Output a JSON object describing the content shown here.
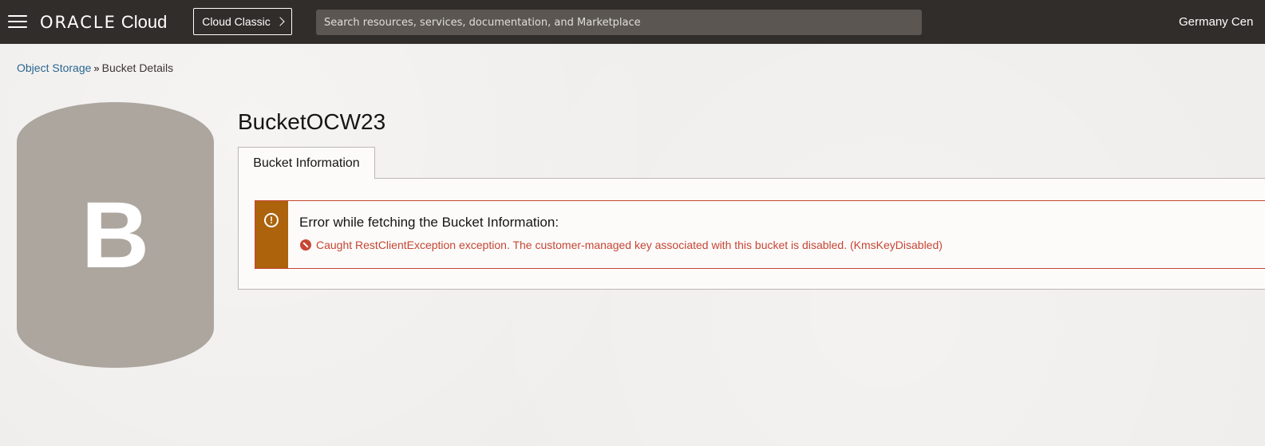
{
  "header": {
    "brand_oracle": "ORACLE",
    "brand_cloud": "Cloud",
    "classic_button_label": "Cloud Classic",
    "search_placeholder": "Search resources, services, documentation, and Marketplace",
    "region_label": "Germany Cen"
  },
  "breadcrumb": {
    "parent_label": "Object Storage",
    "separator": "»",
    "current_label": "Bucket Details"
  },
  "bucket": {
    "badge_letter": "B",
    "name": "BucketOCW23"
  },
  "tabs": [
    {
      "label": "Bucket Information"
    }
  ],
  "alert": {
    "title": "Error while fetching the Bucket Information:",
    "message": "Caught RestClientException exception. The customer-managed key associated with this bucket is disabled. (KmsKeyDisabled)",
    "icon": "exclamation-circle-icon",
    "accent_color": "#ac630c",
    "error_color": "#c74634"
  }
}
